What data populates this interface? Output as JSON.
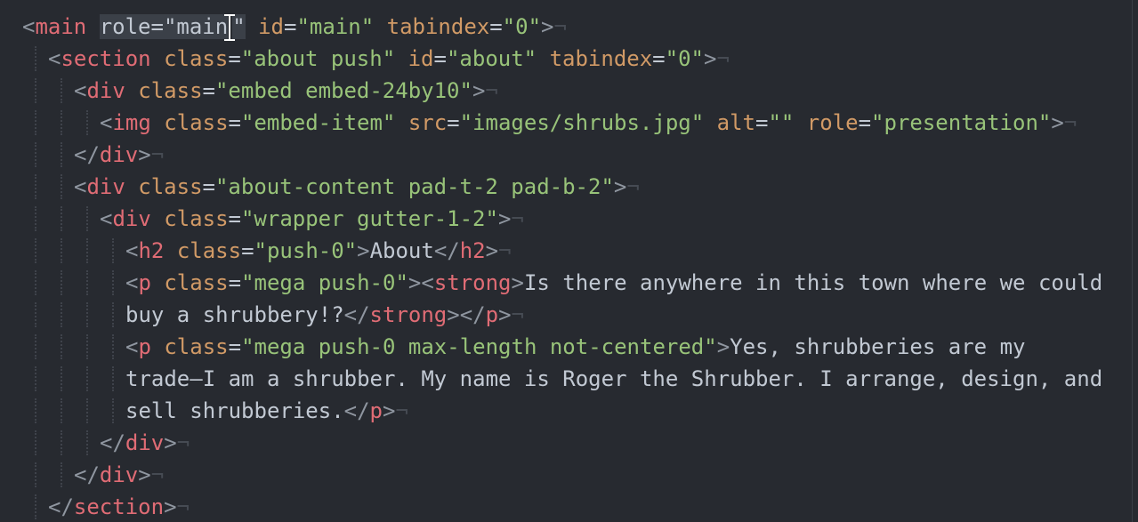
{
  "editor": {
    "eol_marker": "¬",
    "lines": [
      {
        "indent": 0,
        "tokens": [
          [
            "br",
            "<"
          ],
          [
            "tg",
            "main"
          ],
          [
            "tx",
            " "
          ],
          [
            "sel",
            "role"
          ],
          [
            "sel",
            "=\""
          ],
          [
            "sel",
            "main"
          ],
          [
            "caret",
            ""
          ],
          [
            "sel",
            "\""
          ],
          [
            "tx",
            " "
          ],
          [
            "at",
            "id"
          ],
          [
            "eq",
            "="
          ],
          [
            "st",
            "\"main\""
          ],
          [
            "tx",
            " "
          ],
          [
            "at",
            "tabindex"
          ],
          [
            "eq",
            "="
          ],
          [
            "st",
            "\"0\""
          ],
          [
            "br",
            ">"
          ]
        ]
      },
      {
        "indent": 1,
        "tokens": [
          [
            "br",
            "<"
          ],
          [
            "tg",
            "section"
          ],
          [
            "tx",
            " "
          ],
          [
            "at",
            "class"
          ],
          [
            "eq",
            "="
          ],
          [
            "st",
            "\"about push\""
          ],
          [
            "tx",
            " "
          ],
          [
            "at",
            "id"
          ],
          [
            "eq",
            "="
          ],
          [
            "st",
            "\"about\""
          ],
          [
            "tx",
            " "
          ],
          [
            "at",
            "tabindex"
          ],
          [
            "eq",
            "="
          ],
          [
            "st",
            "\"0\""
          ],
          [
            "br",
            ">"
          ]
        ]
      },
      {
        "indent": 2,
        "tokens": [
          [
            "br",
            "<"
          ],
          [
            "tg",
            "div"
          ],
          [
            "tx",
            " "
          ],
          [
            "at",
            "class"
          ],
          [
            "eq",
            "="
          ],
          [
            "st",
            "\"embed embed-24by10\""
          ],
          [
            "br",
            ">"
          ]
        ]
      },
      {
        "indent": 3,
        "tokens": [
          [
            "br",
            "<"
          ],
          [
            "tg",
            "img"
          ],
          [
            "tx",
            " "
          ],
          [
            "at",
            "class"
          ],
          [
            "eq",
            "="
          ],
          [
            "st",
            "\"embed-item\""
          ],
          [
            "tx",
            " "
          ],
          [
            "at",
            "src"
          ],
          [
            "eq",
            "="
          ],
          [
            "st",
            "\"images/shrubs.jpg\""
          ],
          [
            "tx",
            " "
          ],
          [
            "at",
            "alt"
          ],
          [
            "eq",
            "="
          ],
          [
            "st",
            "\"\""
          ],
          [
            "tx",
            " "
          ],
          [
            "at",
            "role"
          ],
          [
            "eq",
            "="
          ],
          [
            "st",
            "\"presentation\""
          ],
          [
            "br",
            ">"
          ]
        ]
      },
      {
        "indent": 2,
        "tokens": [
          [
            "br",
            "</"
          ],
          [
            "tg",
            "div"
          ],
          [
            "br",
            ">"
          ]
        ]
      },
      {
        "indent": 2,
        "tokens": [
          [
            "br",
            "<"
          ],
          [
            "tg",
            "div"
          ],
          [
            "tx",
            " "
          ],
          [
            "at",
            "class"
          ],
          [
            "eq",
            "="
          ],
          [
            "st",
            "\"about-content pad-t-2 pad-b-2\""
          ],
          [
            "br",
            ">"
          ]
        ]
      },
      {
        "indent": 3,
        "tokens": [
          [
            "br",
            "<"
          ],
          [
            "tg",
            "div"
          ],
          [
            "tx",
            " "
          ],
          [
            "at",
            "class"
          ],
          [
            "eq",
            "="
          ],
          [
            "st",
            "\"wrapper gutter-1-2\""
          ],
          [
            "br",
            ">"
          ]
        ]
      },
      {
        "indent": 4,
        "tokens": [
          [
            "br",
            "<"
          ],
          [
            "tg",
            "h2"
          ],
          [
            "tx",
            " "
          ],
          [
            "at",
            "class"
          ],
          [
            "eq",
            "="
          ],
          [
            "st",
            "\"push-0\""
          ],
          [
            "br",
            ">"
          ],
          [
            "tx",
            "About"
          ],
          [
            "br",
            "</"
          ],
          [
            "tg",
            "h2"
          ],
          [
            "br",
            ">"
          ]
        ]
      },
      {
        "indent": 4,
        "noeol": true,
        "tokens": [
          [
            "br",
            "<"
          ],
          [
            "tg",
            "p"
          ],
          [
            "tx",
            " "
          ],
          [
            "at",
            "class"
          ],
          [
            "eq",
            "="
          ],
          [
            "st",
            "\"mega push-0\""
          ],
          [
            "br",
            "><"
          ],
          [
            "tg",
            "strong"
          ],
          [
            "br",
            ">"
          ],
          [
            "tx",
            "Is there anywhere in this town where we could"
          ]
        ]
      },
      {
        "indent": 4,
        "wrap": true,
        "tokens": [
          [
            "tx",
            "buy a shrubbery!?"
          ],
          [
            "br",
            "</"
          ],
          [
            "tg",
            "strong"
          ],
          [
            "br",
            "></"
          ],
          [
            "tg",
            "p"
          ],
          [
            "br",
            ">"
          ]
        ]
      },
      {
        "indent": 4,
        "noeol": true,
        "tokens": [
          [
            "br",
            "<"
          ],
          [
            "tg",
            "p"
          ],
          [
            "tx",
            " "
          ],
          [
            "at",
            "class"
          ],
          [
            "eq",
            "="
          ],
          [
            "st",
            "\"mega push-0 max-length not-centered\""
          ],
          [
            "br",
            ">"
          ],
          [
            "tx",
            "Yes, shrubberies are my"
          ]
        ]
      },
      {
        "indent": 4,
        "wrap": true,
        "noeol": true,
        "tokens": [
          [
            "tx",
            "trade—I am a shrubber. My name is Roger the Shrubber. I arrange, design, and"
          ]
        ]
      },
      {
        "indent": 4,
        "wrap": true,
        "tokens": [
          [
            "tx",
            "sell shrubberies."
          ],
          [
            "br",
            "</"
          ],
          [
            "tg",
            "p"
          ],
          [
            "br",
            ">"
          ]
        ]
      },
      {
        "indent": 3,
        "tokens": [
          [
            "br",
            "</"
          ],
          [
            "tg",
            "div"
          ],
          [
            "br",
            ">"
          ]
        ]
      },
      {
        "indent": 2,
        "tokens": [
          [
            "br",
            "</"
          ],
          [
            "tg",
            "div"
          ],
          [
            "br",
            ">"
          ]
        ]
      },
      {
        "indent": 1,
        "tokens": [
          [
            "br",
            "</"
          ],
          [
            "tg",
            "section"
          ],
          [
            "br",
            ">"
          ]
        ]
      }
    ]
  }
}
